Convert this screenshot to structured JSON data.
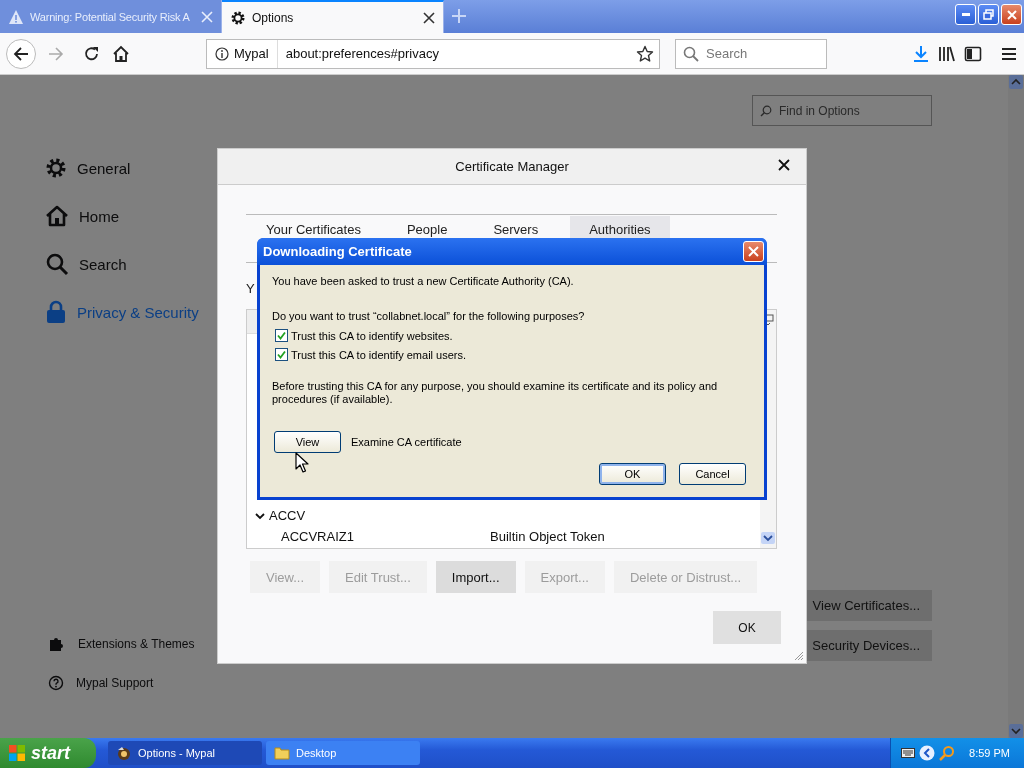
{
  "browser_tabs": [
    {
      "title": "Warning: Potential Security Risk A",
      "kind": "warning",
      "selected": false
    },
    {
      "title": "Options",
      "kind": "settings",
      "selected": true
    }
  ],
  "toolbar": {
    "site_label": "Mypal",
    "url": "about:preferences#privacy",
    "search_placeholder": "Search"
  },
  "preferences": {
    "search_placeholder": "Find in Options",
    "categories": [
      {
        "label": "General",
        "kind": "gear",
        "selected": false
      },
      {
        "label": "Home",
        "kind": "home",
        "selected": false
      },
      {
        "label": "Search",
        "kind": "search",
        "selected": false
      },
      {
        "label": "Privacy & Security",
        "kind": "lock",
        "selected": true
      }
    ],
    "footer_links": [
      {
        "label": "Extensions & Themes",
        "kind": "puzzle"
      },
      {
        "label": "Mypal Support",
        "kind": "help"
      }
    ],
    "buttons": [
      "View Certificates...",
      "Security Devices..."
    ]
  },
  "certificate_manager": {
    "title": "Certificate Manager",
    "tabs": [
      {
        "label": "Your Certificates",
        "selected": false
      },
      {
        "label": "People",
        "selected": false
      },
      {
        "label": "Servers",
        "selected": false
      },
      {
        "label": "Authorities",
        "selected": true
      }
    ],
    "intro": "Y",
    "tree": [
      {
        "name": "ACCV",
        "expanded": true,
        "children": [
          {
            "name": "ACCVRAIZ1",
            "token": "Builtin Object Token"
          }
        ]
      }
    ],
    "actions": [
      {
        "label": "View...",
        "disabled": true
      },
      {
        "label": "Edit Trust...",
        "disabled": true
      },
      {
        "label": "Import...",
        "disabled": false
      },
      {
        "label": "Export...",
        "disabled": true
      },
      {
        "label": "Delete or Distrust...",
        "disabled": true
      }
    ],
    "ok": "OK"
  },
  "download_dialog": {
    "title": "Downloading Certificate",
    "message": "You have been asked to trust a new Certificate Authority (CA).",
    "question": "Do you want to trust “collabnet.local” for the following purposes?",
    "options": [
      {
        "label": "Trust this CA to identify websites.",
        "checked": true
      },
      {
        "label": "Trust this CA to identify email users.",
        "checked": true
      }
    ],
    "advice": "Before trusting this CA for any purpose, you should examine its certificate and its policy and procedures (if available).",
    "view_button": "View",
    "view_note": "Examine CA certificate",
    "buttons": [
      {
        "label": "OK",
        "default": true
      },
      {
        "label": "Cancel",
        "default": false
      }
    ]
  },
  "taskbar": {
    "start": "start",
    "windows": [
      {
        "label": "Options - Mypal",
        "kind": "app",
        "selected": true
      },
      {
        "label": "Desktop",
        "kind": "folder",
        "selected": false
      }
    ],
    "clock": "8:59 PM"
  }
}
